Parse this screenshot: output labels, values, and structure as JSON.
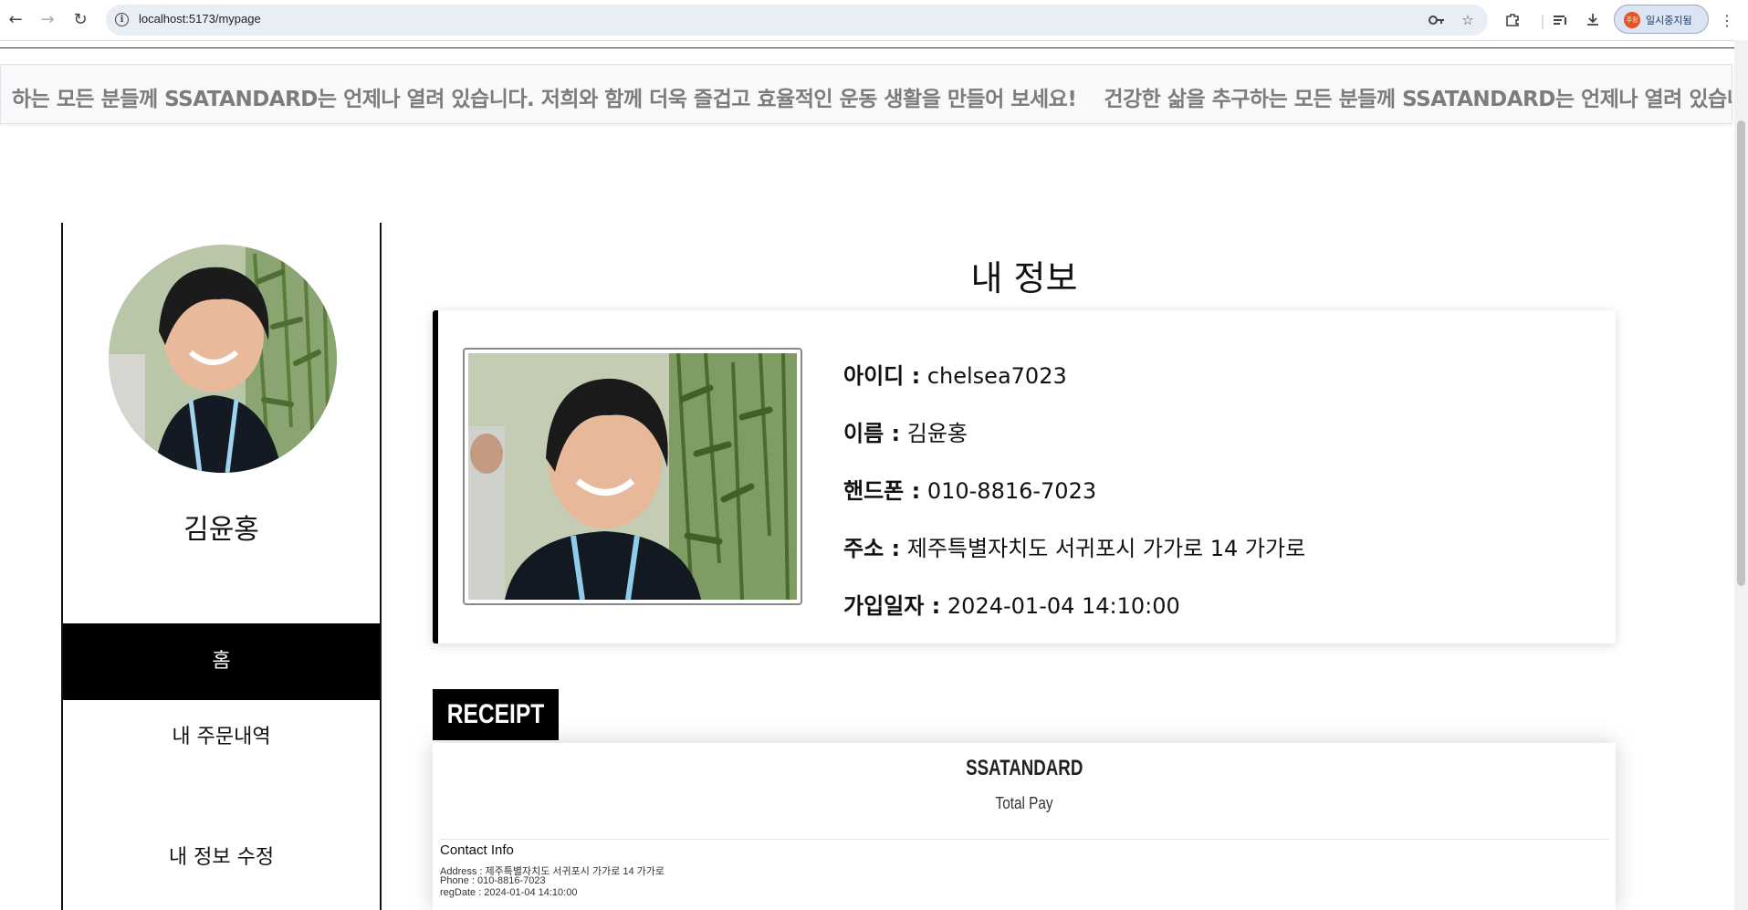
{
  "browser": {
    "url": "localhost:5173/mypage",
    "profile_label": "일시중지됨",
    "profile_avatar_text": "주정"
  },
  "banner": {
    "text": "하는 모든 분들께 SSATANDARD는 언제나 열려 있습니다. 저희와 함께 더욱 즐겁고 효율적인 운동 생활을 만들어 보세요!",
    "text_2": "건강한 삶을 추구하는 모든 분들께 SSATANDARD는 언제나 열려 있습니다. 저"
  },
  "sidebar": {
    "user_name": "김윤홍",
    "menu": [
      {
        "label": "홈",
        "active": true
      },
      {
        "label": "내 주문내역",
        "active": false
      },
      {
        "label": "내 정보 수정",
        "active": false
      }
    ]
  },
  "main": {
    "title": "내 정보",
    "fields": [
      {
        "key": "아이디 :",
        "value": " chelsea7023"
      },
      {
        "key": "이름 :",
        "value": " 김윤홍"
      },
      {
        "key": "핸드폰 :",
        "value": " 010-8816-7023"
      },
      {
        "key": "주소 :",
        "value": " 제주특별자치도 서귀포시 가가로 14 가가로"
      },
      {
        "key": "가입일자 :",
        "value": " 2024-01-04 14:10:00"
      }
    ]
  },
  "receipt": {
    "tab_label": "RECEIPT",
    "store_name": "SSATANDARD",
    "total_label": "Total Pay",
    "contact_title": "Contact Info",
    "address": "Address : 제주특별자치도 서귀포시 가가로 14 가가로",
    "phone": "Phone : 010-8816-7023",
    "reg_date": "regDate : 2024-01-04 14:10:00"
  }
}
